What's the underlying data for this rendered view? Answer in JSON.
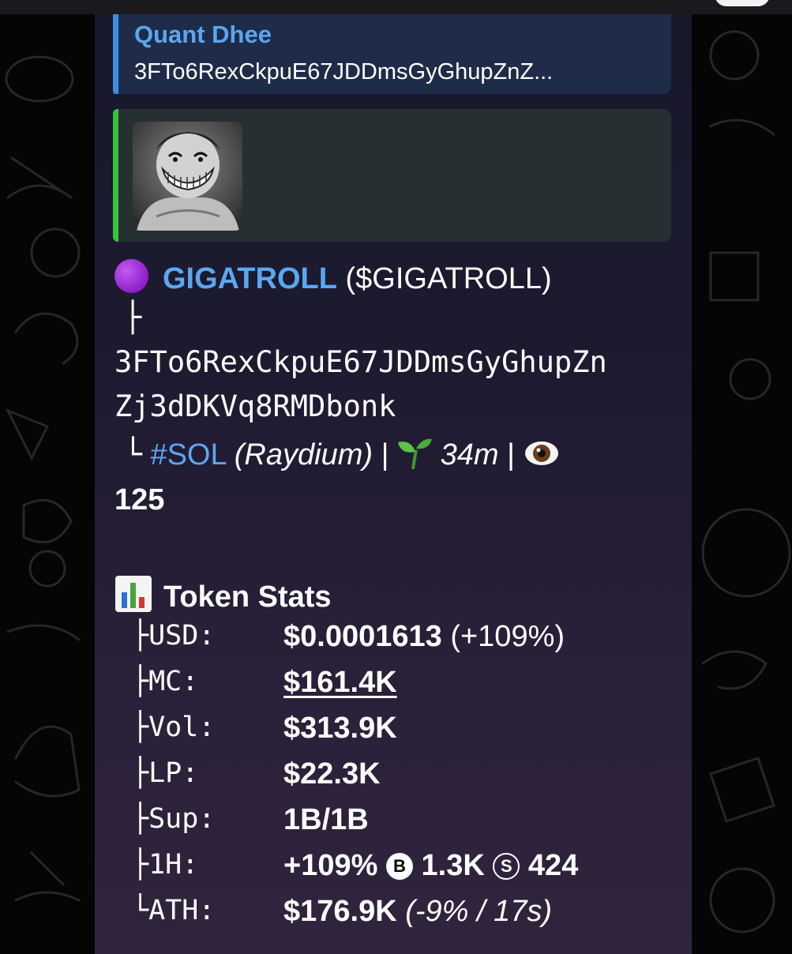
{
  "reply": {
    "name": "Quant Dhee",
    "text": "3FTo6RexCkpuE67JDDmsGyGhupZnZ..."
  },
  "token": {
    "name": "GIGATROLL",
    "ticker": "($GIGATROLL)",
    "tree_branch": "├",
    "address_line1": "3FTo6RexCkpuE67JDDmsGyGhupZn",
    "address_line2": "Zj3dDKVq8RMDbonk",
    "tree_end": "└",
    "chain": "#SOL",
    "dex": "(Raydium)",
    "sep1": "|",
    "age": "34m",
    "sep2": "|",
    "views": "125"
  },
  "stats": {
    "heading": "Token Stats",
    "rows": [
      {
        "key": "├USD:",
        "value": "$0.0001613",
        "extra": "(+109%)"
      },
      {
        "key": "├MC:",
        "value": "$161.4K"
      },
      {
        "key": "├Vol:",
        "value": "$313.9K"
      },
      {
        "key": "├LP:",
        "value": "$22.3K"
      },
      {
        "key": "├Sup:",
        "value": "1B/1B"
      },
      {
        "key": "├1H:",
        "value": "+109%",
        "buys_badge": "B",
        "buys": "1.3K",
        "sells_badge": "S",
        "sells": "424"
      },
      {
        "key": "└ATH:",
        "value": "$176.9K",
        "extra": "(-9% / 17s)"
      }
    ]
  },
  "colors": {
    "link": "#5aa7f0",
    "reply_bar": "#3b8fe0",
    "preview_bar": "#36c43a",
    "token_dot": "#8d1ec9"
  }
}
